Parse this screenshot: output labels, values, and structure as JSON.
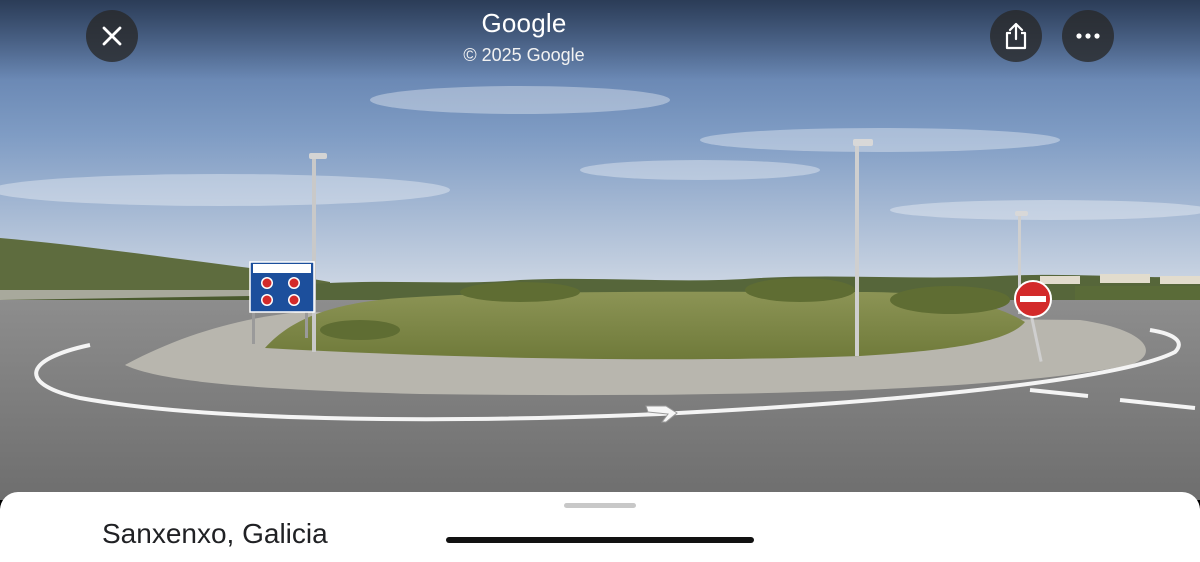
{
  "header": {
    "title": "Google",
    "copyright": "© 2025 Google"
  },
  "icons": {
    "close": "close-icon",
    "share": "share-icon",
    "more": "more-horizontal-icon"
  },
  "scene": {
    "navigation_arrow": "chevron-arrow-icon"
  },
  "sheet": {
    "place_name": "Sanxenxo, Galicia"
  },
  "colors": {
    "sky_top": "#5d7fb2",
    "sky_bottom": "#c9d5e3",
    "grass": "#7f8a4a",
    "road": "#7b7b7b",
    "sheet_bg": "#ffffff",
    "sign_blue": "#1c4f9c",
    "sign_red": "#d32a2a"
  }
}
